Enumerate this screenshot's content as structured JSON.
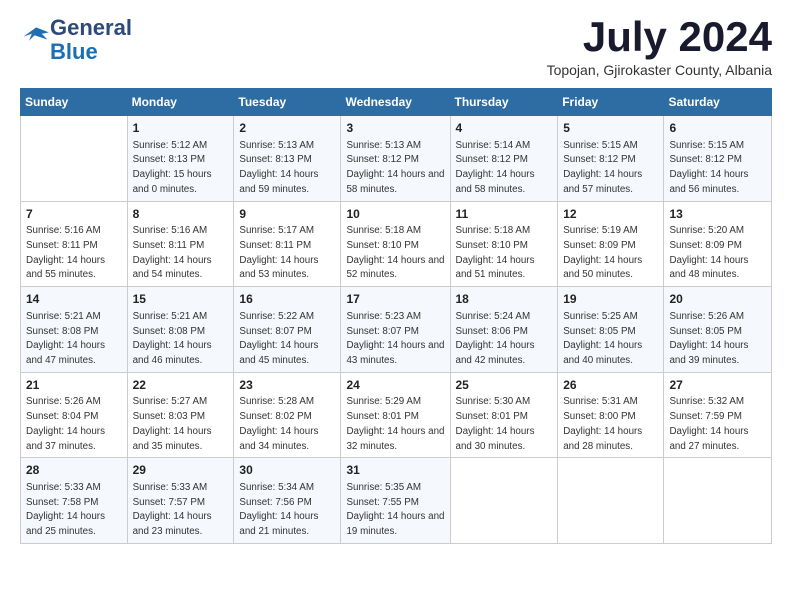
{
  "logo": {
    "general": "General",
    "blue": "Blue"
  },
  "title": "July 2024",
  "subtitle": "Topojan, Gjirokaster County, Albania",
  "days_of_week": [
    "Sunday",
    "Monday",
    "Tuesday",
    "Wednesday",
    "Thursday",
    "Friday",
    "Saturday"
  ],
  "weeks": [
    [
      {
        "day": "",
        "sunrise": "",
        "sunset": "",
        "daylight": ""
      },
      {
        "day": "1",
        "sunrise": "5:12 AM",
        "sunset": "8:13 PM",
        "daylight": "15 hours and 0 minutes."
      },
      {
        "day": "2",
        "sunrise": "5:13 AM",
        "sunset": "8:13 PM",
        "daylight": "14 hours and 59 minutes."
      },
      {
        "day": "3",
        "sunrise": "5:13 AM",
        "sunset": "8:12 PM",
        "daylight": "14 hours and 58 minutes."
      },
      {
        "day": "4",
        "sunrise": "5:14 AM",
        "sunset": "8:12 PM",
        "daylight": "14 hours and 58 minutes."
      },
      {
        "day": "5",
        "sunrise": "5:15 AM",
        "sunset": "8:12 PM",
        "daylight": "14 hours and 57 minutes."
      },
      {
        "day": "6",
        "sunrise": "5:15 AM",
        "sunset": "8:12 PM",
        "daylight": "14 hours and 56 minutes."
      }
    ],
    [
      {
        "day": "7",
        "sunrise": "5:16 AM",
        "sunset": "8:11 PM",
        "daylight": "14 hours and 55 minutes."
      },
      {
        "day": "8",
        "sunrise": "5:16 AM",
        "sunset": "8:11 PM",
        "daylight": "14 hours and 54 minutes."
      },
      {
        "day": "9",
        "sunrise": "5:17 AM",
        "sunset": "8:11 PM",
        "daylight": "14 hours and 53 minutes."
      },
      {
        "day": "10",
        "sunrise": "5:18 AM",
        "sunset": "8:10 PM",
        "daylight": "14 hours and 52 minutes."
      },
      {
        "day": "11",
        "sunrise": "5:18 AM",
        "sunset": "8:10 PM",
        "daylight": "14 hours and 51 minutes."
      },
      {
        "day": "12",
        "sunrise": "5:19 AM",
        "sunset": "8:09 PM",
        "daylight": "14 hours and 50 minutes."
      },
      {
        "day": "13",
        "sunrise": "5:20 AM",
        "sunset": "8:09 PM",
        "daylight": "14 hours and 48 minutes."
      }
    ],
    [
      {
        "day": "14",
        "sunrise": "5:21 AM",
        "sunset": "8:08 PM",
        "daylight": "14 hours and 47 minutes."
      },
      {
        "day": "15",
        "sunrise": "5:21 AM",
        "sunset": "8:08 PM",
        "daylight": "14 hours and 46 minutes."
      },
      {
        "day": "16",
        "sunrise": "5:22 AM",
        "sunset": "8:07 PM",
        "daylight": "14 hours and 45 minutes."
      },
      {
        "day": "17",
        "sunrise": "5:23 AM",
        "sunset": "8:07 PM",
        "daylight": "14 hours and 43 minutes."
      },
      {
        "day": "18",
        "sunrise": "5:24 AM",
        "sunset": "8:06 PM",
        "daylight": "14 hours and 42 minutes."
      },
      {
        "day": "19",
        "sunrise": "5:25 AM",
        "sunset": "8:05 PM",
        "daylight": "14 hours and 40 minutes."
      },
      {
        "day": "20",
        "sunrise": "5:26 AM",
        "sunset": "8:05 PM",
        "daylight": "14 hours and 39 minutes."
      }
    ],
    [
      {
        "day": "21",
        "sunrise": "5:26 AM",
        "sunset": "8:04 PM",
        "daylight": "14 hours and 37 minutes."
      },
      {
        "day": "22",
        "sunrise": "5:27 AM",
        "sunset": "8:03 PM",
        "daylight": "14 hours and 35 minutes."
      },
      {
        "day": "23",
        "sunrise": "5:28 AM",
        "sunset": "8:02 PM",
        "daylight": "14 hours and 34 minutes."
      },
      {
        "day": "24",
        "sunrise": "5:29 AM",
        "sunset": "8:01 PM",
        "daylight": "14 hours and 32 minutes."
      },
      {
        "day": "25",
        "sunrise": "5:30 AM",
        "sunset": "8:01 PM",
        "daylight": "14 hours and 30 minutes."
      },
      {
        "day": "26",
        "sunrise": "5:31 AM",
        "sunset": "8:00 PM",
        "daylight": "14 hours and 28 minutes."
      },
      {
        "day": "27",
        "sunrise": "5:32 AM",
        "sunset": "7:59 PM",
        "daylight": "14 hours and 27 minutes."
      }
    ],
    [
      {
        "day": "28",
        "sunrise": "5:33 AM",
        "sunset": "7:58 PM",
        "daylight": "14 hours and 25 minutes."
      },
      {
        "day": "29",
        "sunrise": "5:33 AM",
        "sunset": "7:57 PM",
        "daylight": "14 hours and 23 minutes."
      },
      {
        "day": "30",
        "sunrise": "5:34 AM",
        "sunset": "7:56 PM",
        "daylight": "14 hours and 21 minutes."
      },
      {
        "day": "31",
        "sunrise": "5:35 AM",
        "sunset": "7:55 PM",
        "daylight": "14 hours and 19 minutes."
      },
      {
        "day": "",
        "sunrise": "",
        "sunset": "",
        "daylight": ""
      },
      {
        "day": "",
        "sunrise": "",
        "sunset": "",
        "daylight": ""
      },
      {
        "day": "",
        "sunrise": "",
        "sunset": "",
        "daylight": ""
      }
    ]
  ],
  "labels": {
    "sunrise": "Sunrise:",
    "sunset": "Sunset:",
    "daylight": "Daylight:"
  }
}
